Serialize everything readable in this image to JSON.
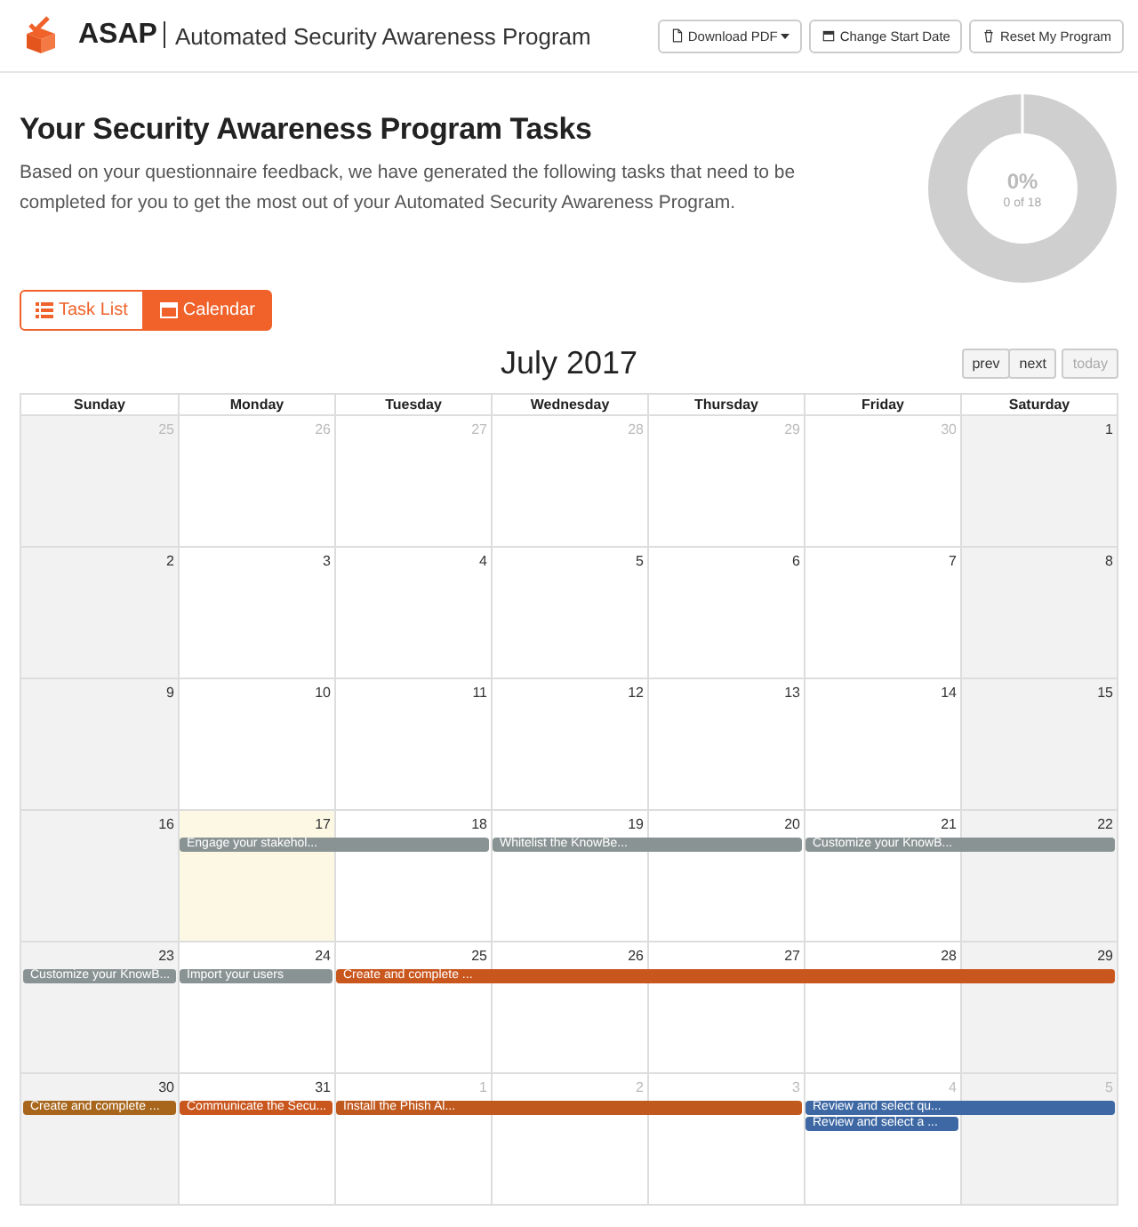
{
  "header": {
    "brand": "ASAP",
    "title": "Automated Security Awareness Program",
    "buttons": [
      {
        "kind": "download",
        "label": "Download PDF"
      },
      {
        "kind": "date",
        "label": "Change Start Date"
      },
      {
        "kind": "reset",
        "label": "Reset My Program"
      }
    ]
  },
  "intro": {
    "title": "Your Security Awareness Program Tasks",
    "text": "Based on your questionnaire feedback, we have generated the following tasks that need to be completed for you to get the most out of your Automated Security Awareness Program."
  },
  "progress": {
    "percent": "0%",
    "count": "0 of 18",
    "level": 0
  },
  "view_tabs": [
    {
      "kind": "list",
      "label": "Task List",
      "selected": false
    },
    {
      "kind": "calendar",
      "label": "Calendar",
      "selected": true
    }
  ],
  "calendar": {
    "title": "July 2017",
    "nav": [
      {
        "label": "prev",
        "disabled": false
      },
      {
        "label": "next",
        "disabled": false
      }
    ],
    "today_button": {
      "label": "today",
      "disabled": true
    },
    "weekdays": [
      "Sunday",
      "Monday",
      "Tuesday",
      "Wednesday",
      "Thursday",
      "Friday",
      "Saturday"
    ],
    "weeks": [
      {
        "days": [
          {
            "number": "25",
            "other_month": true,
            "today": false
          },
          {
            "number": "26",
            "other_month": true,
            "today": false
          },
          {
            "number": "27",
            "other_month": true,
            "today": false
          },
          {
            "number": "28",
            "other_month": true,
            "today": false
          },
          {
            "number": "29",
            "other_month": true,
            "today": false
          },
          {
            "number": "30",
            "other_month": true,
            "today": false
          },
          {
            "number": "1",
            "other_month": false,
            "today": false
          }
        ]
      },
      {
        "days": [
          {
            "number": "2",
            "other_month": false,
            "today": false
          },
          {
            "number": "3",
            "other_month": false,
            "today": false
          },
          {
            "number": "4",
            "other_month": false,
            "today": false
          },
          {
            "number": "5",
            "other_month": false,
            "today": false
          },
          {
            "number": "6",
            "other_month": false,
            "today": false
          },
          {
            "number": "7",
            "other_month": false,
            "today": false
          },
          {
            "number": "8",
            "other_month": false,
            "today": false
          }
        ]
      },
      {
        "days": [
          {
            "number": "9",
            "other_month": false,
            "today": false
          },
          {
            "number": "10",
            "other_month": false,
            "today": false
          },
          {
            "number": "11",
            "other_month": false,
            "today": false
          },
          {
            "number": "12",
            "other_month": false,
            "today": false
          },
          {
            "number": "13",
            "other_month": false,
            "today": false
          },
          {
            "number": "14",
            "other_month": false,
            "today": false
          },
          {
            "number": "15",
            "other_month": false,
            "today": false
          }
        ]
      },
      {
        "days": [
          {
            "number": "16",
            "other_month": false,
            "today": false
          },
          {
            "number": "17",
            "other_month": false,
            "today": true,
            "events": [
              {
                "kind": "start",
                "title": "Engage your stakehol...",
                "color": "#8a9393"
              }
            ]
          },
          {
            "number": "18",
            "other_month": false,
            "today": false,
            "events": [
              {
                "kind": "cont"
              }
            ]
          },
          {
            "number": "19",
            "other_month": false,
            "today": false,
            "events": [
              {
                "kind": "start",
                "title": "Whitelist the KnowBe...",
                "color": "#8a9393"
              }
            ]
          },
          {
            "number": "20",
            "other_month": false,
            "today": false,
            "events": [
              {
                "kind": "cont"
              }
            ]
          },
          {
            "number": "21",
            "other_month": false,
            "today": false,
            "events": [
              {
                "kind": "start",
                "title": "Customize your KnowB...",
                "color": "#8a9393"
              }
            ]
          },
          {
            "number": "22",
            "other_month": false,
            "today": false,
            "events": [
              {
                "kind": "cont"
              }
            ]
          }
        ]
      },
      {
        "days": [
          {
            "number": "23",
            "other_month": false,
            "today": false,
            "events": [
              {
                "kind": "start",
                "title": "Customize your KnowB...",
                "color": "#8a9393"
              }
            ]
          },
          {
            "number": "24",
            "other_month": false,
            "today": false,
            "events": [
              {
                "kind": "start",
                "title": "Import your users",
                "color": "#8a9393"
              }
            ]
          },
          {
            "number": "25",
            "other_month": false,
            "today": false,
            "events": [
              {
                "kind": "start",
                "title": "Create and complete ...",
                "color": "#c9561d"
              }
            ]
          },
          {
            "number": "26",
            "other_month": false,
            "today": false,
            "events": [
              {
                "kind": "cont"
              }
            ]
          },
          {
            "number": "27",
            "other_month": false,
            "today": false,
            "events": [
              {
                "kind": "cont"
              }
            ]
          },
          {
            "number": "28",
            "other_month": false,
            "today": false,
            "events": [
              {
                "kind": "cont"
              }
            ]
          },
          {
            "number": "29",
            "other_month": false,
            "today": false,
            "events": [
              {
                "kind": "cont"
              }
            ]
          }
        ]
      },
      {
        "days": [
          {
            "number": "30",
            "other_month": false,
            "today": false,
            "events": [
              {
                "kind": "start",
                "title": "Create and complete ...",
                "color": "#a8661c"
              }
            ]
          },
          {
            "number": "31",
            "other_month": false,
            "today": false,
            "events": [
              {
                "kind": "start",
                "title": "Communicate the Secu...",
                "color": "#c9561d"
              }
            ]
          },
          {
            "number": "1",
            "other_month": true,
            "today": false,
            "events": [
              {
                "kind": "start",
                "title": "Install the Phish Al...",
                "color": "#c0591d"
              }
            ]
          },
          {
            "number": "2",
            "other_month": true,
            "today": false,
            "events": [
              {
                "kind": "cont"
              }
            ]
          },
          {
            "number": "3",
            "other_month": true,
            "today": false,
            "events": [
              {
                "kind": "cont"
              }
            ]
          },
          {
            "number": "4",
            "other_month": true,
            "today": false,
            "events": [
              {
                "kind": "start",
                "title": "Review and select qu...",
                "color": "#3d68a4"
              },
              {
                "kind": "start",
                "title": "Review and select a ...",
                "color": "#3d68a4"
              }
            ]
          },
          {
            "number": "5",
            "other_month": true,
            "today": false,
            "events": [
              {
                "kind": "cont"
              }
            ]
          }
        ]
      }
    ]
  }
}
